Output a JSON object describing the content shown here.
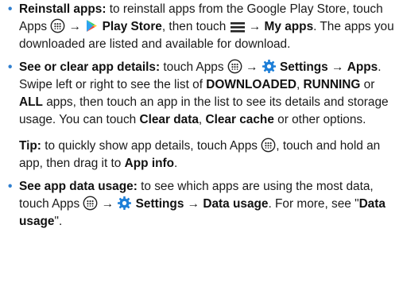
{
  "items": [
    {
      "title": "Reinstall apps:",
      "t1": " to reinstall apps from the Google Play Store, touch Apps ",
      "arrow1": " → ",
      "bold1": "Play Store",
      "t2": ", then touch ",
      "arrow2": " → ",
      "bold2": "My apps",
      "t3": ". The apps you downloaded are listed and available for download."
    },
    {
      "title": "See or clear app details:",
      "t1": " touch Apps ",
      "arrow1": " → ",
      "bold1": "Settings",
      "arrow2": " → ",
      "bold2": "Apps",
      "t2": ". Swipe left or right to see the list of ",
      "bold3": "DOWNLOADED",
      "t3": ", ",
      "bold4": "RUNNING",
      "t4": " or ",
      "bold5": "ALL",
      "t5": " apps, then touch an app in the list to see its details and storage usage. You can touch ",
      "bold6": "Clear data",
      "t6": ", ",
      "bold7": "Clear cache",
      "t7": " or other options."
    },
    {
      "title": "See app data usage:",
      "t1": " to see which apps are using the most data, touch Apps ",
      "arrow1": " → ",
      "bold1": "Settings",
      "arrow2": " → ",
      "bold2": "Data usage",
      "t2": ". For more, see \"",
      "bold3": "Data usage",
      "t3": "\"."
    }
  ],
  "tip": {
    "label": "Tip:",
    "t1": " to quickly show app details, touch Apps ",
    "t2": ", touch and hold an app, then drag it to ",
    "bold1": "App info",
    "t3": "."
  },
  "colors": {
    "bullet": "#2f7fd0",
    "gear": "#1e7fd8",
    "play_green": "#3bcc6b",
    "play_blue": "#2da3f0",
    "play_yellow": "#ffc933",
    "play_red": "#f0493c"
  },
  "icons": [
    "apps-icon",
    "play-store-icon",
    "menu-icon",
    "settings-gear-icon"
  ]
}
